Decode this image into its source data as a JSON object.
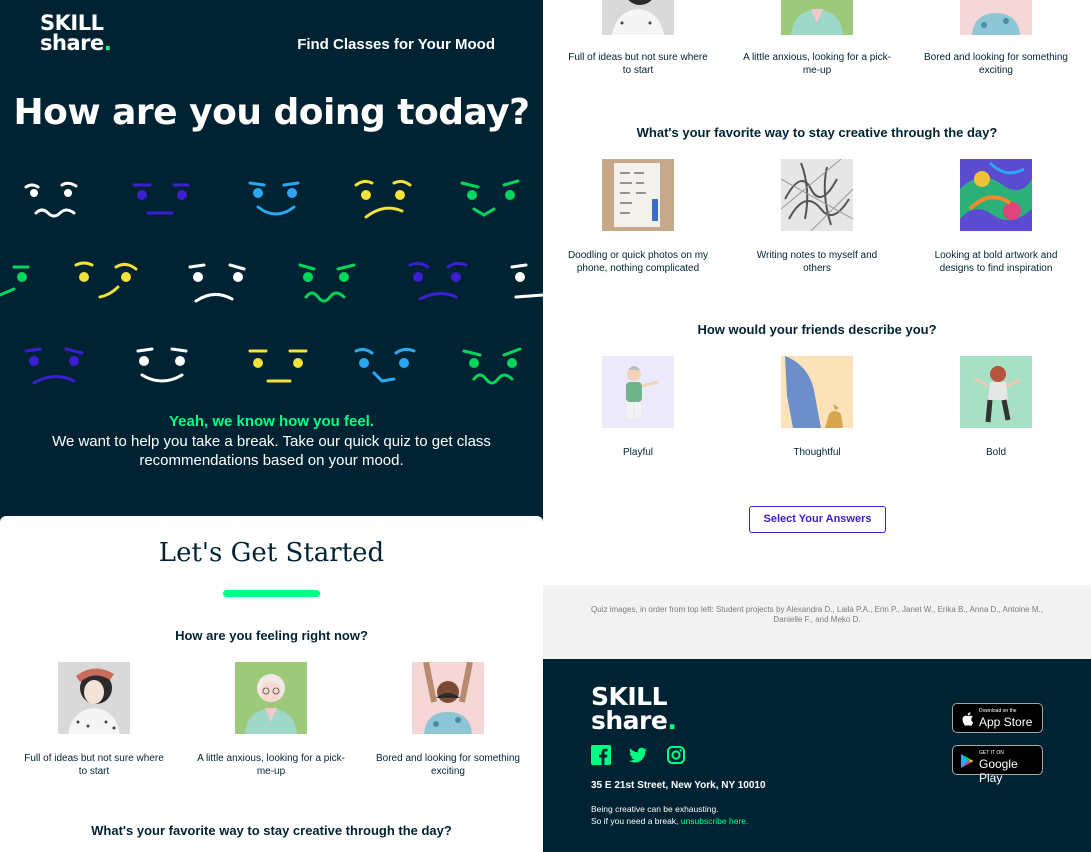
{
  "brand": {
    "logo_line1": "SKILL",
    "logo_line2": "share",
    "logo_dot": ".",
    "accent_color": "#00ff84",
    "dark_color": "#002333",
    "link_color": "#3b1fd0"
  },
  "hero": {
    "tagline": "Find Classes for Your Mood",
    "title": "How are you doing today?",
    "green_text": "Yeah, we know how you feel.",
    "body": "We want to help you take a break. Take our quick quiz to get class recommendations based on your mood."
  },
  "quiz": {
    "title": "Let's Get Started",
    "questions": [
      {
        "question": "How are you feeling right now?",
        "options": [
          "Full of ideas but not sure where to start",
          "A little anxious, looking for a pick-me-up",
          "Bored and looking for something exciting"
        ]
      },
      {
        "question": "What's your favorite way to stay creative through the day?",
        "options": [
          "Doodling or quick photos on my phone, nothing complicated",
          "Writing notes to myself and others",
          "Looking at bold artwork and designs to find inspiration"
        ]
      },
      {
        "question": "How would your friends describe you?",
        "options": [
          "Playful",
          "Thoughtful",
          "Bold"
        ]
      }
    ],
    "cta": "Select Your Answers"
  },
  "credits": "Quiz images, in order from top left: Student projects by Alexandra D., Laila P.A., Erin P., Janet W., Erika B., Anna D., Antoine M., Danielle F., and Meko D.",
  "footer": {
    "address": "35 E 21st Street, New York, NY 10010",
    "note_line1": "Being creative can be exhausting.",
    "note_line2": "So if you need a break, ",
    "unsubscribe": "unsubscribe here.",
    "app_store_small": "Download on the",
    "app_store_big": "App Store",
    "google_small": "GET IT ON",
    "google_big": "Google Play",
    "social_icons": [
      "facebook-icon",
      "twitter-icon",
      "instagram-icon"
    ]
  }
}
